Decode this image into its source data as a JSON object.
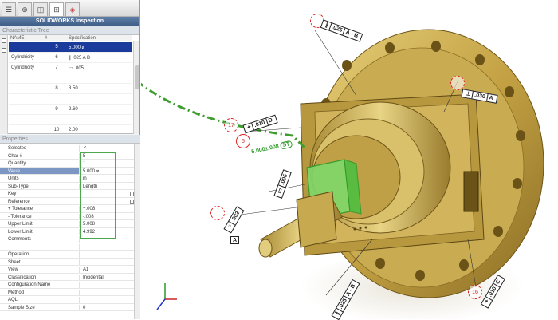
{
  "toolbar": {
    "tabs": [
      "fm-icon",
      "target-icon",
      "config-icon",
      "inspection-icon",
      "appearance-icon"
    ]
  },
  "app_title": "SOLIDWORKS Inspection",
  "tree": {
    "section_title": "Characteristic Tree",
    "columns": [
      "NAME",
      "#",
      "Specification"
    ],
    "rows": [
      {
        "name": "",
        "num": "5",
        "spec": "5.000 ⌀",
        "selected": true
      },
      {
        "name": "Cylindricity",
        "num": "6",
        "spec": "∥ .025 A B",
        "selected": false
      },
      {
        "name": "Cylindricity",
        "num": "7",
        "spec": "▭ .005",
        "selected": false
      },
      {
        "name": "",
        "num": "",
        "spec": "",
        "selected": false
      },
      {
        "name": "",
        "num": "8",
        "spec": "3.50",
        "selected": false
      },
      {
        "name": "",
        "num": "",
        "spec": "",
        "selected": false
      },
      {
        "name": "",
        "num": "9",
        "spec": "2.60",
        "selected": false
      },
      {
        "name": "",
        "num": "",
        "spec": "",
        "selected": false
      },
      {
        "name": "",
        "num": "10",
        "spec": "2.00",
        "selected": false
      }
    ]
  },
  "properties": {
    "section_title": "Properties",
    "rows": [
      {
        "label": "Selected",
        "value": "✓"
      },
      {
        "label": "Char #",
        "value": "5"
      },
      {
        "label": "Quantity",
        "value": "1"
      },
      {
        "label": "Value",
        "value": "5.000 ⌀"
      },
      {
        "label": "Units",
        "value": "in"
      },
      {
        "label": "Sub-Type",
        "value": "Length"
      },
      {
        "label": "Key",
        "value": ""
      },
      {
        "label": "Reference",
        "value": ""
      },
      {
        "label": "+ Tolerance",
        "value": "+.008"
      },
      {
        "label": "- Tolerance",
        "value": "-.008"
      },
      {
        "label": "Upper Limit",
        "value": "5.008"
      },
      {
        "label": "Lower Limit",
        "value": "4.992"
      },
      {
        "label": "Comments",
        "value": ""
      },
      {
        "label": "",
        "value": ""
      },
      {
        "label": "Operation",
        "value": ""
      },
      {
        "label": "Sheet",
        "value": ""
      },
      {
        "label": "View",
        "value": "A1"
      },
      {
        "label": "Classification",
        "value": "Incidental"
      },
      {
        "label": "Configuration Name",
        "value": ""
      },
      {
        "label": "Method",
        "value": ""
      },
      {
        "label": "AQL",
        "value": ""
      },
      {
        "label": "Sample Size",
        "value": "0"
      }
    ]
  },
  "annotations": {
    "balloons": [
      "17",
      "5",
      "16"
    ],
    "dim_callout": "5.000±.008",
    "dim_tag": "ST",
    "fcf_top": [
      "∥",
      ".025",
      "A - B"
    ],
    "fcf_right": [
      "⊥",
      ".030",
      "A"
    ],
    "fcf_mid": [
      "⌖",
      ".010",
      "D"
    ],
    "fcf_small": ".005",
    "fcf_left": ".002",
    "datum_a": "A",
    "fcf_bottom": [
      "∥",
      ".025",
      "A - B"
    ],
    "fcf_bottom_right": [
      "⌖",
      ".010",
      "C"
    ]
  },
  "colors": {
    "accent": "#1a3a9c",
    "highlight_green": "#4ca84c",
    "part_gold": "#c8a94a",
    "balloon_red": "#d22222"
  }
}
